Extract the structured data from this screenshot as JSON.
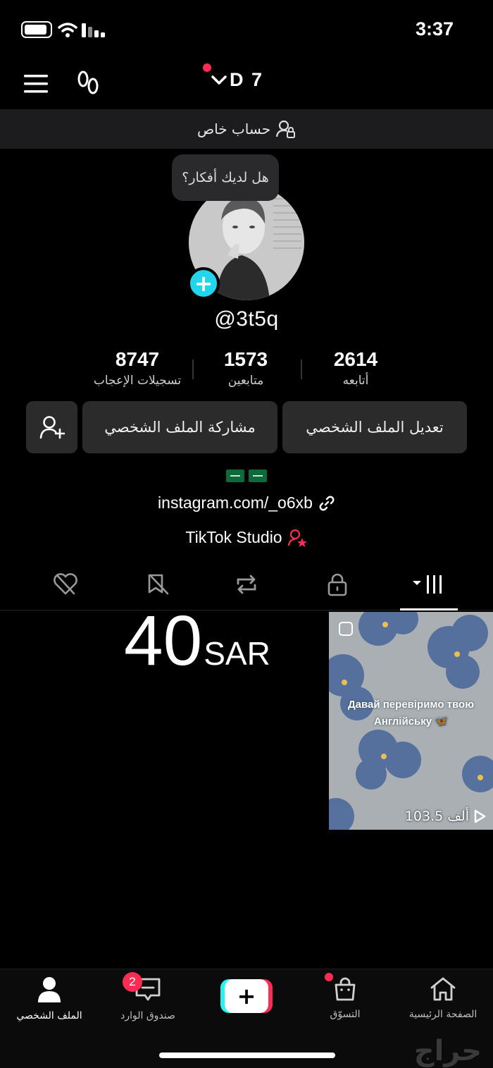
{
  "status": {
    "time": "3:37"
  },
  "nav": {
    "account_name": "D 7"
  },
  "banner": {
    "text": "حساب خاص",
    "icon": "private-user-lock-icon"
  },
  "profile": {
    "bubble_text": "هل لديك أفكار؟",
    "username": "@3t5q",
    "stats": [
      {
        "value": "2614",
        "label": "أتابعه"
      },
      {
        "value": "1573",
        "label": "متابعين"
      },
      {
        "value": "8747",
        "label": "تسجيلات الإعجاب"
      }
    ],
    "buttons": {
      "edit": "تعديل الملف الشخصي",
      "share": "مشاركة الملف الشخصي"
    },
    "bio_flags": "🇸🇦 🇸🇦",
    "link": "instagram.com/_o6xb",
    "studio": "TikTok Studio"
  },
  "tabs": [
    "videos-grid",
    "private",
    "reposts",
    "favorites",
    "liked"
  ],
  "content": {
    "price_value": "40",
    "price_currency": "SAR",
    "video": {
      "caption": "Давай перевіримо твою Англійську 🦋",
      "views": "103.5 ألف"
    }
  },
  "bottom_nav": [
    {
      "label": "الصفحة الرئيسية",
      "icon": "home-icon"
    },
    {
      "label": "التسوّق",
      "icon": "shop-bag-icon"
    },
    {
      "label": "",
      "icon": "create-icon"
    },
    {
      "label": "صندوق الوارد",
      "icon": "inbox-icon",
      "badge": "2"
    },
    {
      "label": "الملف الشخصي",
      "icon": "profile-icon"
    }
  ],
  "watermark": "حراج",
  "colors": {
    "accent": "#fe2c55",
    "cyan": "#25f4ee",
    "plus_badge": "#20d5ec"
  }
}
